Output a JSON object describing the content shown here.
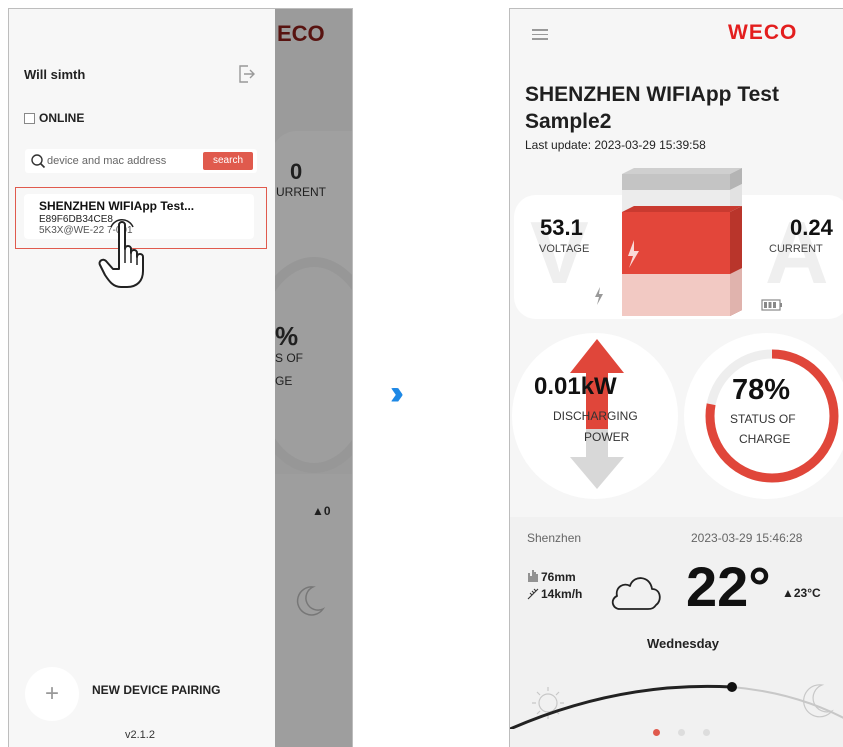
{
  "left_screen": {
    "user_name": "Will simth",
    "online_label": "ONLINE",
    "search": {
      "placeholder": "device and mac address",
      "button_label": "search"
    },
    "device": {
      "title": "SHENZHEN WIFIApp Test...",
      "mac": "E89F6DB34CE8",
      "sn": "5K3X@WE-22   7-001"
    },
    "pairing_label": "NEW DEVICE PAIRING",
    "version": "v2.1.2",
    "background": {
      "logo_fragment": "ECO",
      "current_value": "0",
      "current_label": "URRENT",
      "percent_fragment": "%",
      "status_fragment1": "S OF",
      "status_fragment2": "GE",
      "trend_value": "▲0"
    }
  },
  "transition_arrow": "›››",
  "right_screen": {
    "logo": "WECO",
    "device_name": "SHENZHEN WIFIApp Test Sample2",
    "last_update": "Last update:  2023-03-29 15:39:58",
    "voltage": {
      "value": "53.1",
      "label": "VOLTAGE",
      "watermark": "V"
    },
    "current": {
      "value": "0.24",
      "label": "CURRENT",
      "watermark": "A"
    },
    "power": {
      "value": "0.01kW",
      "label_line1": "DISCHARGING",
      "label_line2": "POWER"
    },
    "soc": {
      "value": "78%",
      "percent": 78,
      "label_line1": "STATUS OF",
      "label_line2": "CHARGE"
    },
    "weather": {
      "city": "Shenzhen",
      "datetime": "2023-03-29 15:46:28",
      "rain": "76mm",
      "wind": "14km/h",
      "temperature": "22°",
      "high": "▲23°C",
      "day": "Wednesday"
    },
    "page_indicator": {
      "total": 3,
      "active": 1
    }
  },
  "colors": {
    "accent": "#e05a4d",
    "logo_red": "#e31e1e",
    "arrow_blue": "#1e88e5"
  }
}
